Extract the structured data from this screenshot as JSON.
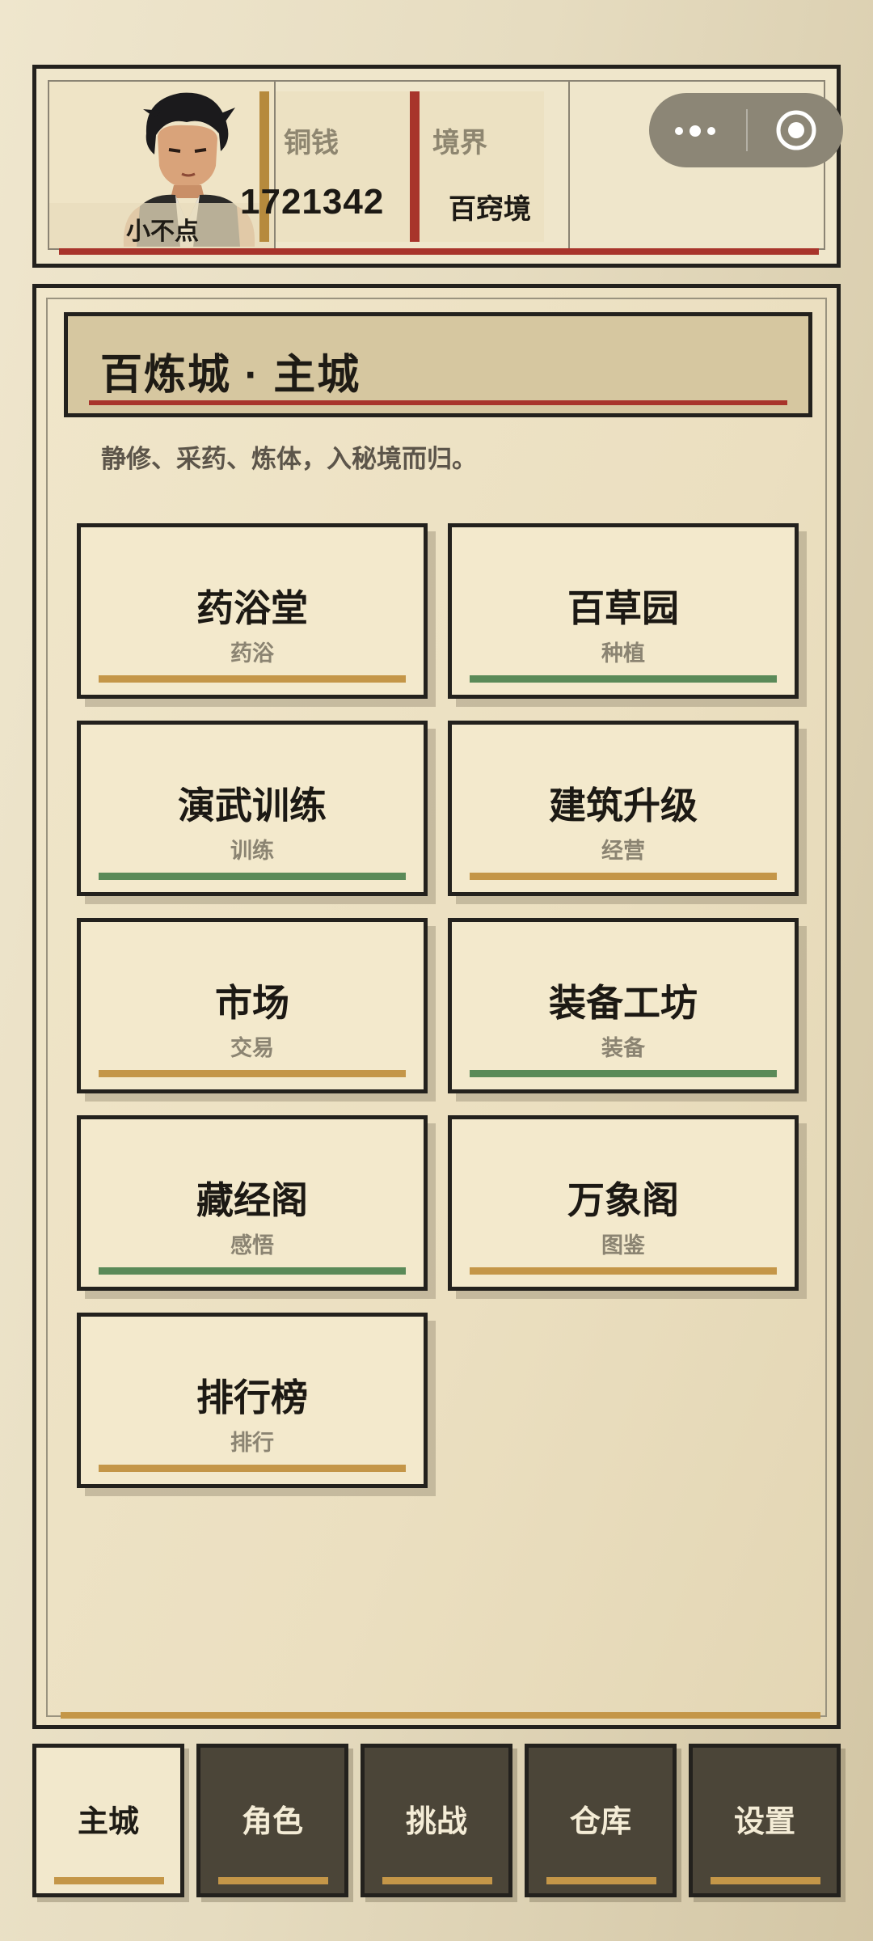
{
  "header": {
    "player_name": "小不点",
    "coin_label": "铜钱",
    "coin_value": "1721342",
    "realm_label": "境界",
    "realm_value": "百窍境",
    "avatar_icon": "hero-portrait-icon"
  },
  "capsule": {
    "more_icon": "more-dots-icon",
    "close_icon": "target-circle-icon"
  },
  "main": {
    "title": "百炼城 · 主城",
    "subtitle": "静修、采药、炼体，入秘境而归。",
    "cards": [
      {
        "title": "药浴堂",
        "sub": "药浴",
        "color": "#c49648"
      },
      {
        "title": "百草园",
        "sub": "种植",
        "color": "#5a8a58"
      },
      {
        "title": "演武训练",
        "sub": "训练",
        "color": "#5a8a58"
      },
      {
        "title": "建筑升级",
        "sub": "经营",
        "color": "#c49648"
      },
      {
        "title": "市场",
        "sub": "交易",
        "color": "#c49648"
      },
      {
        "title": "装备工坊",
        "sub": "装备",
        "color": "#5a8a58"
      },
      {
        "title": "藏经阁",
        "sub": "感悟",
        "color": "#5a8a58"
      },
      {
        "title": "万象阁",
        "sub": "图鉴",
        "color": "#c49648"
      },
      {
        "title": "排行榜",
        "sub": "排行",
        "color": "#c49648"
      }
    ]
  },
  "tabs": [
    {
      "label": "主城",
      "active": true
    },
    {
      "label": "角色",
      "active": false
    },
    {
      "label": "挑战",
      "active": false
    },
    {
      "label": "仓库",
      "active": false
    },
    {
      "label": "设置",
      "active": false
    }
  ],
  "colors": {
    "accent_red": "#a8342b",
    "accent_gold": "#c49648",
    "accent_green": "#5a8a58",
    "dark": "#23211d",
    "paper": "#f3e9cc"
  }
}
